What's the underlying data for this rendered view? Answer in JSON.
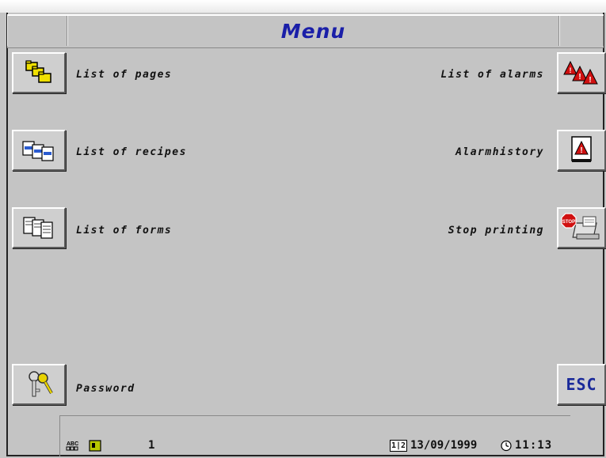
{
  "header": {
    "title": "Menu"
  },
  "left_buttons": [
    {
      "label": "List of pages",
      "icon": "folders-icon"
    },
    {
      "label": "List of recipes",
      "icon": "recipes-icon"
    },
    {
      "label": "List of forms",
      "icon": "forms-icon"
    },
    {
      "label": "Password",
      "icon": "keys-icon"
    }
  ],
  "right_buttons": [
    {
      "label": "List of alarms",
      "icon": "alarms-icon"
    },
    {
      "label": "Alarmhistory",
      "icon": "alarm-history-icon"
    },
    {
      "label": "Stop printing",
      "icon": "stop-printer-icon"
    },
    {
      "label": "ESC",
      "icon": ""
    }
  ],
  "status": {
    "abc_label": "ABC",
    "page_number": "1",
    "calendar_label": "1|2",
    "date": "13/09/1999",
    "time": "11:13"
  },
  "colors": {
    "background": "#c4c4c4",
    "title": "#1a1fa8",
    "esc": "#1a2a9a",
    "alarm_red": "#d01010",
    "folder_yellow": "#f0e000"
  }
}
